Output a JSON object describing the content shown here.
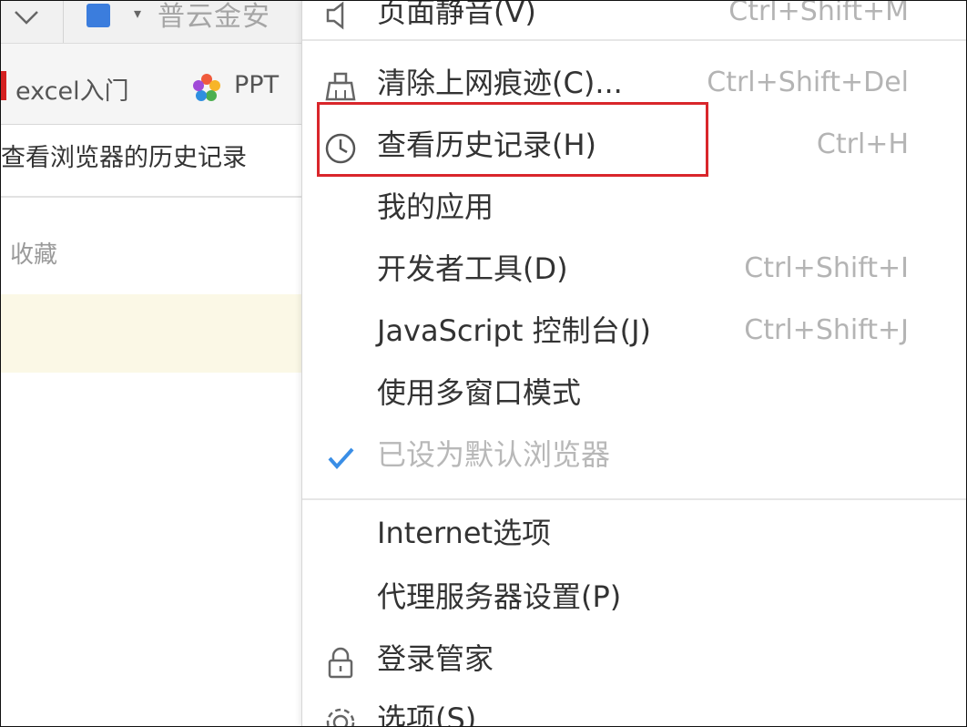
{
  "toolbar": {
    "search_text": "普云金安"
  },
  "bookmarks": [
    {
      "label": "excel入门"
    },
    {
      "label": "PPT"
    }
  ],
  "tab_title": "查看浏览器的历史记录",
  "favorites_label": "收藏",
  "menu": {
    "items": [
      {
        "label": "页面静音(V)",
        "shortcut": "Ctrl+Shift+M",
        "icon": "speaker-icon"
      },
      {
        "label": "清除上网痕迹(C)...",
        "shortcut": "Ctrl+Shift+Del",
        "icon": "broom-icon"
      },
      {
        "label": "查看历史记录(H)",
        "shortcut": "Ctrl+H",
        "icon": "clock-icon"
      },
      {
        "label": "我的应用",
        "shortcut": ""
      },
      {
        "label": "开发者工具(D)",
        "shortcut": "Ctrl+Shift+I"
      },
      {
        "label": "JavaScript 控制台(J)",
        "shortcut": "Ctrl+Shift+J"
      },
      {
        "label": "使用多窗口模式",
        "shortcut": ""
      },
      {
        "label": "已设为默认浏览器",
        "shortcut": "",
        "icon": "checkmark-icon",
        "disabled": true
      },
      {
        "label": "Internet选项",
        "shortcut": ""
      },
      {
        "label": "代理服务器设置(P)",
        "shortcut": ""
      },
      {
        "label": "登录管家",
        "shortcut": "",
        "icon": "lock-icon"
      },
      {
        "label": "选项(S)",
        "shortcut": "",
        "icon": "gear-icon"
      }
    ]
  },
  "colors": {
    "highlight_border": "#d9262b",
    "check_blue": "#3a8ee6"
  }
}
